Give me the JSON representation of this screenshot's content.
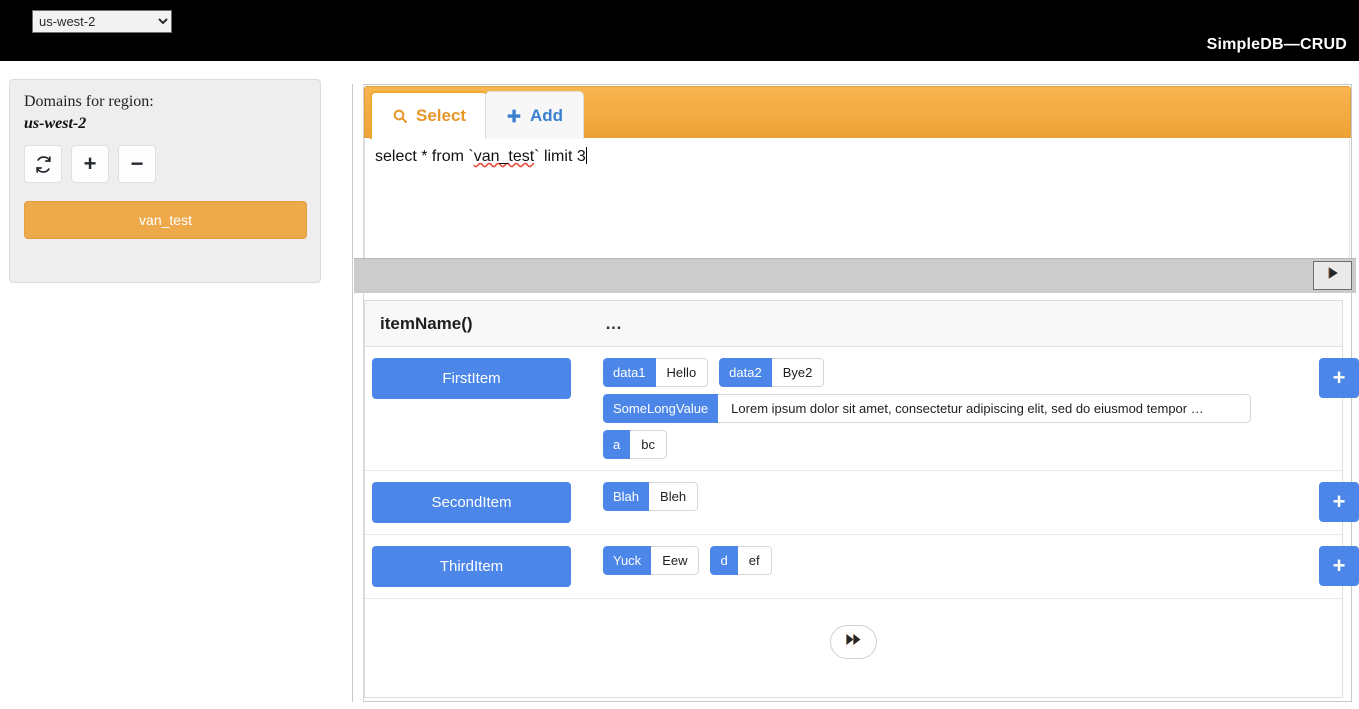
{
  "topbar": {
    "region_value": "us-west-2",
    "region_options": [
      "us-west-2"
    ],
    "app_title": "SimpleDB—CRUD"
  },
  "sidebar": {
    "title": "Domains for region:",
    "region": "us-west-2",
    "actions": [
      {
        "name": "refresh",
        "label": "↻"
      },
      {
        "name": "add",
        "label": "+"
      },
      {
        "name": "remove",
        "label": "−"
      }
    ],
    "domains": [
      "van_test"
    ]
  },
  "tabs": [
    {
      "label": "Select",
      "icon": "search-icon",
      "active": true
    },
    {
      "label": "Add",
      "icon": "plus-icon",
      "active": false
    }
  ],
  "editor": {
    "query_prefix": "select * from `",
    "query_domain": "van_test",
    "query_suffix": "` limit 3",
    "run_label": "▶"
  },
  "results": {
    "header": {
      "item_col": "itemName()",
      "attrs_col": "…"
    },
    "add_attr_label": "+",
    "more_label": "⏭",
    "rows": [
      {
        "item": "FirstItem",
        "attr_lines": [
          [
            {
              "key": "data1",
              "value": "Hello",
              "wide": false
            },
            {
              "key": "data2",
              "value": "Bye2",
              "wide": false
            }
          ],
          [
            {
              "key": "SomeLongValue",
              "value": "Lorem ipsum dolor sit amet, consectetur adipiscing elit, sed do eiusmod tempor …",
              "wide": true
            }
          ],
          [
            {
              "key": "a",
              "value": "bc",
              "wide": false
            }
          ]
        ]
      },
      {
        "item": "SecondItem",
        "attr_lines": [
          [
            {
              "key": "Blah",
              "value": "Bleh",
              "wide": false
            }
          ]
        ]
      },
      {
        "item": "ThirdItem",
        "attr_lines": [
          [
            {
              "key": "Yuck",
              "value": "Eew",
              "wide": false
            },
            {
              "key": "d",
              "value": "ef",
              "wide": false
            }
          ]
        ]
      }
    ]
  },
  "colors": {
    "accent_orange": "#eda94a",
    "accent_blue": "#4b86e8",
    "topbar_bg": "#000000",
    "sidebar_bg": "#eeeeee"
  }
}
